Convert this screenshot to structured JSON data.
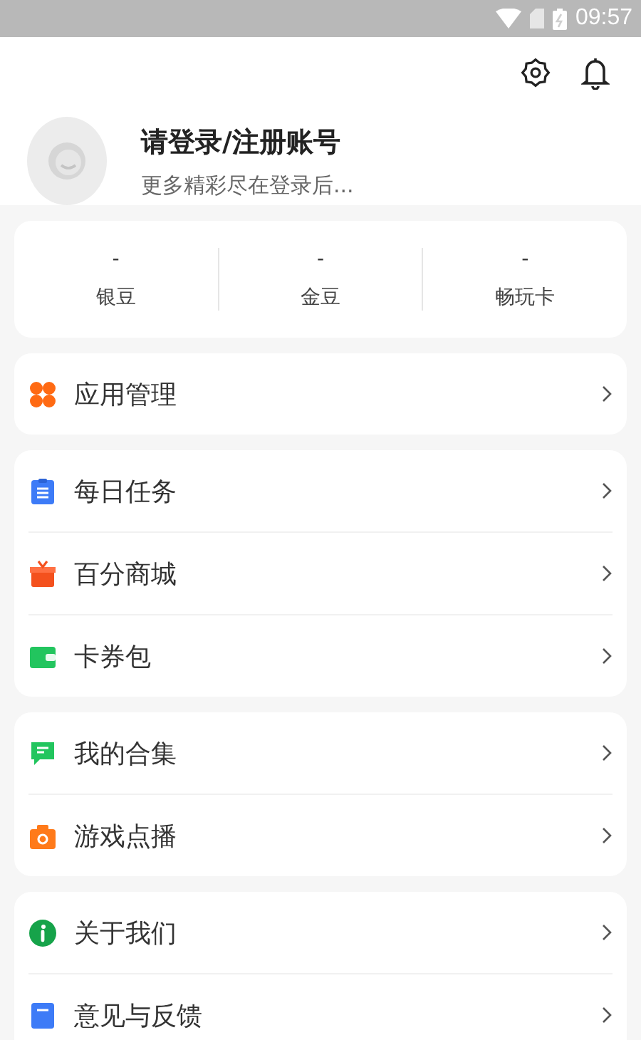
{
  "status_bar": {
    "time": "09:57"
  },
  "profile": {
    "title": "请登录/注册账号",
    "subtitle": "更多精彩尽在登录后..."
  },
  "stats": [
    {
      "value": "-",
      "label": "银豆"
    },
    {
      "value": "-",
      "label": "金豆"
    },
    {
      "value": "-",
      "label": "畅玩卡"
    }
  ],
  "groups": [
    {
      "items": [
        {
          "kind": "apps",
          "label": "应用管理"
        }
      ]
    },
    {
      "items": [
        {
          "kind": "task",
          "label": "每日任务"
        },
        {
          "kind": "gift",
          "label": "百分商城"
        },
        {
          "kind": "wallet",
          "label": "卡券包"
        }
      ]
    },
    {
      "items": [
        {
          "kind": "chat",
          "label": "我的合集"
        },
        {
          "kind": "camera",
          "label": "游戏点播"
        }
      ]
    },
    {
      "items": [
        {
          "kind": "info",
          "label": "关于我们"
        },
        {
          "kind": "doc",
          "label": "意见与反馈"
        }
      ]
    }
  ]
}
